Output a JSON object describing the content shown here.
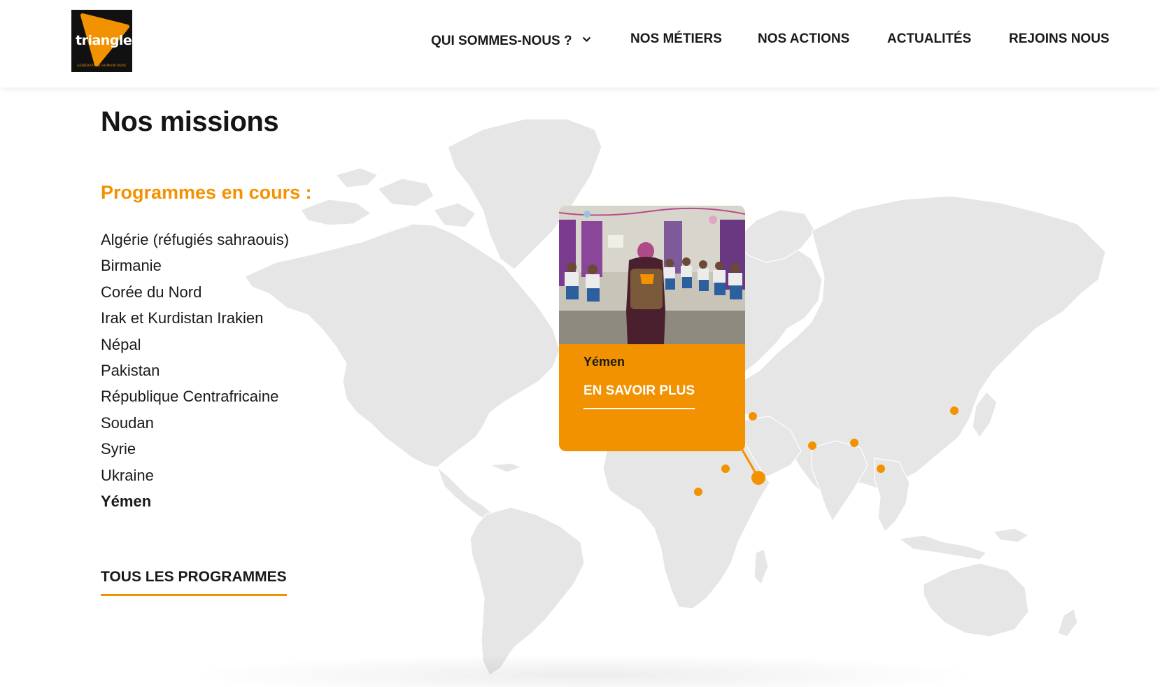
{
  "header": {
    "logo": {
      "word": "triangle",
      "tagline": "GÉNÉRATION HUMANITAIRE"
    },
    "nav": [
      {
        "label": "QUI SOMMES-NOUS ?",
        "has_dropdown": true
      },
      {
        "label": "NOS MÉTIERS"
      },
      {
        "label": "NOS ACTIONS"
      },
      {
        "label": "ACTUALITÉS"
      },
      {
        "label": "REJOINS NOUS"
      }
    ]
  },
  "main": {
    "title": "Nos missions",
    "subtitle": "Programmes en cours :",
    "programmes": [
      "Algérie (réfugiés sahraouis)",
      "Birmanie",
      "Corée du Nord",
      "Irak et Kurdistan Irakien",
      "Népal",
      "Pakistan",
      "République Centrafricaine",
      "Soudan",
      "Syrie",
      "Ukraine",
      "Yémen"
    ],
    "active_programme": "Yémen",
    "all_programmes_link": "TOUS LES PROGRAMMES"
  },
  "card": {
    "country": "Yémen",
    "cta": "EN SAVOIR PLUS"
  },
  "colors": {
    "accent": "#f39200",
    "text": "#1a1a1a",
    "map_land": "#e6e6e6",
    "background": "#ffffff"
  }
}
